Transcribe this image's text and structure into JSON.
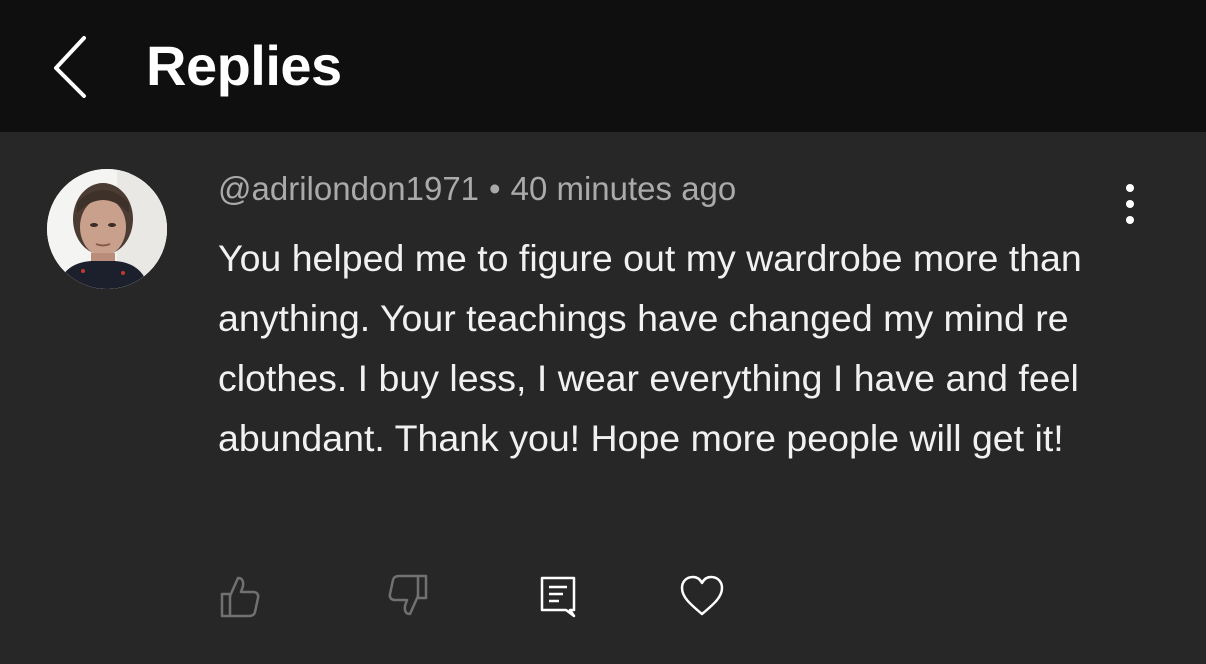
{
  "header": {
    "title": "Replies",
    "back_icon": "chevron-left-icon"
  },
  "comment": {
    "author": "@adrilondon1971",
    "separator": "•",
    "time": "40 minutes ago",
    "text": "You helped me to figure out my wardrobe more than anything. Your teachings have changed my mind re clothes. I buy less, I wear everything I have and feel abundant. Thank you! Hope more people will get it!",
    "actions": [
      {
        "name": "like",
        "icon": "thumbs-up-icon"
      },
      {
        "name": "dislike",
        "icon": "thumbs-down-icon"
      },
      {
        "name": "reply",
        "icon": "comment-icon"
      },
      {
        "name": "heart",
        "icon": "heart-icon"
      }
    ]
  },
  "colors": {
    "header_bg": "#0f0f0f",
    "body_bg": "#272727",
    "text_primary": "#f1f1f1",
    "text_secondary": "#aaaaaa",
    "icon_muted": "#717171"
  }
}
